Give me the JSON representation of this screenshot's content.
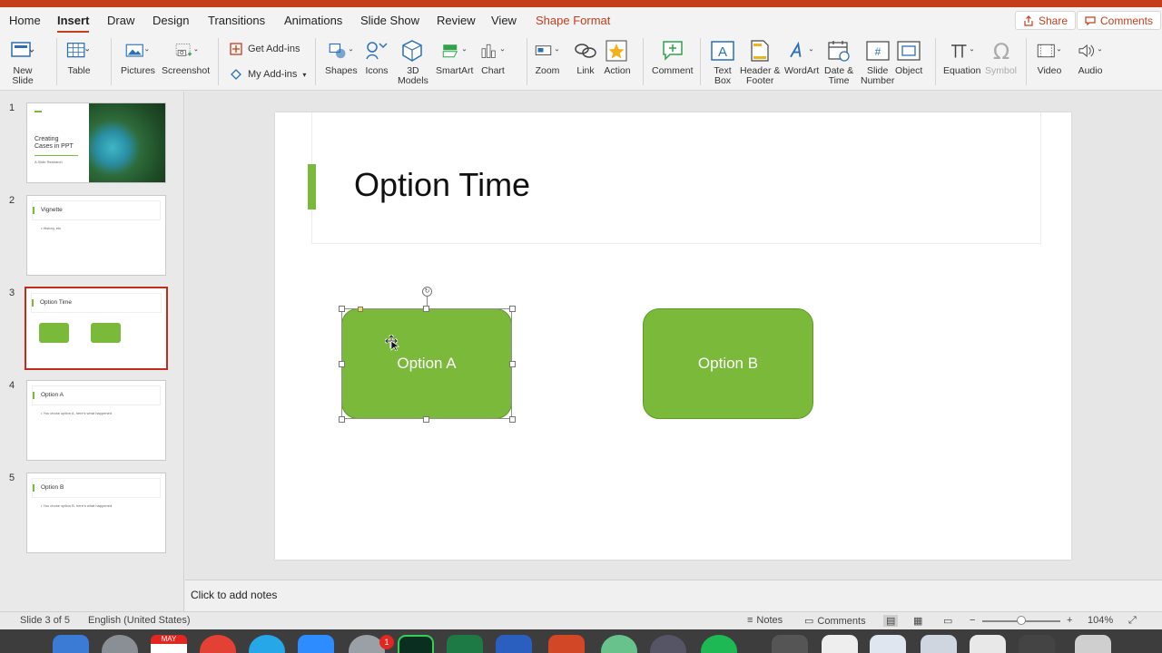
{
  "tabs": [
    "Home",
    "Insert",
    "Draw",
    "Design",
    "Transitions",
    "Animations",
    "Slide Show",
    "Review",
    "View",
    "Shape Format"
  ],
  "top_buttons": {
    "share": "Share",
    "comments": "Comments"
  },
  "ribbon": {
    "new_slide": "New\nSlide",
    "table": "Table",
    "pictures": "Pictures",
    "screenshot": "Screenshot",
    "get_addins": "Get Add-ins",
    "my_addins": "My Add-ins",
    "shapes": "Shapes",
    "icons": "Icons",
    "models": "3D\nModels",
    "smartart": "SmartArt",
    "chart": "Chart",
    "zoom": "Zoom",
    "link": "Link",
    "action": "Action",
    "comment": "Comment",
    "textbox": "Text\nBox",
    "header_footer": "Header &\nFooter",
    "wordart": "WordArt",
    "datetime": "Date &\nTime",
    "slide_number": "Slide\nNumber",
    "object": "Object",
    "equation": "Equation",
    "symbol": "Symbol",
    "video": "Video",
    "audio": "Audio"
  },
  "thumbnails": [
    {
      "num": "1",
      "title": "Creating\nCases in PPT",
      "subtitle": "A Slide Research"
    },
    {
      "num": "2",
      "title": "Vignette",
      "bullet": "• History, etc"
    },
    {
      "num": "3",
      "title": "Option Time"
    },
    {
      "num": "4",
      "title": "Option A",
      "bullet": "• You chose option A, here's what happened"
    },
    {
      "num": "5",
      "title": "Option B",
      "bullet": "• You chose option B, here's what happened"
    }
  ],
  "slide": {
    "title": "Option Time",
    "option_a": "Option A",
    "option_b": "Option B"
  },
  "notes_placeholder": "Click to add notes",
  "status": {
    "slide_count": "Slide 3 of 5",
    "language": "English (United States)",
    "notes": "Notes",
    "comments": "Comments",
    "zoom": "104%"
  },
  "dock": {
    "calendar_month": "MAY",
    "mail_badge": "1"
  },
  "colors": {
    "accent": "#c43e1c",
    "shape_green": "#7ab93a",
    "selected_thumb": "#c42b1c"
  }
}
